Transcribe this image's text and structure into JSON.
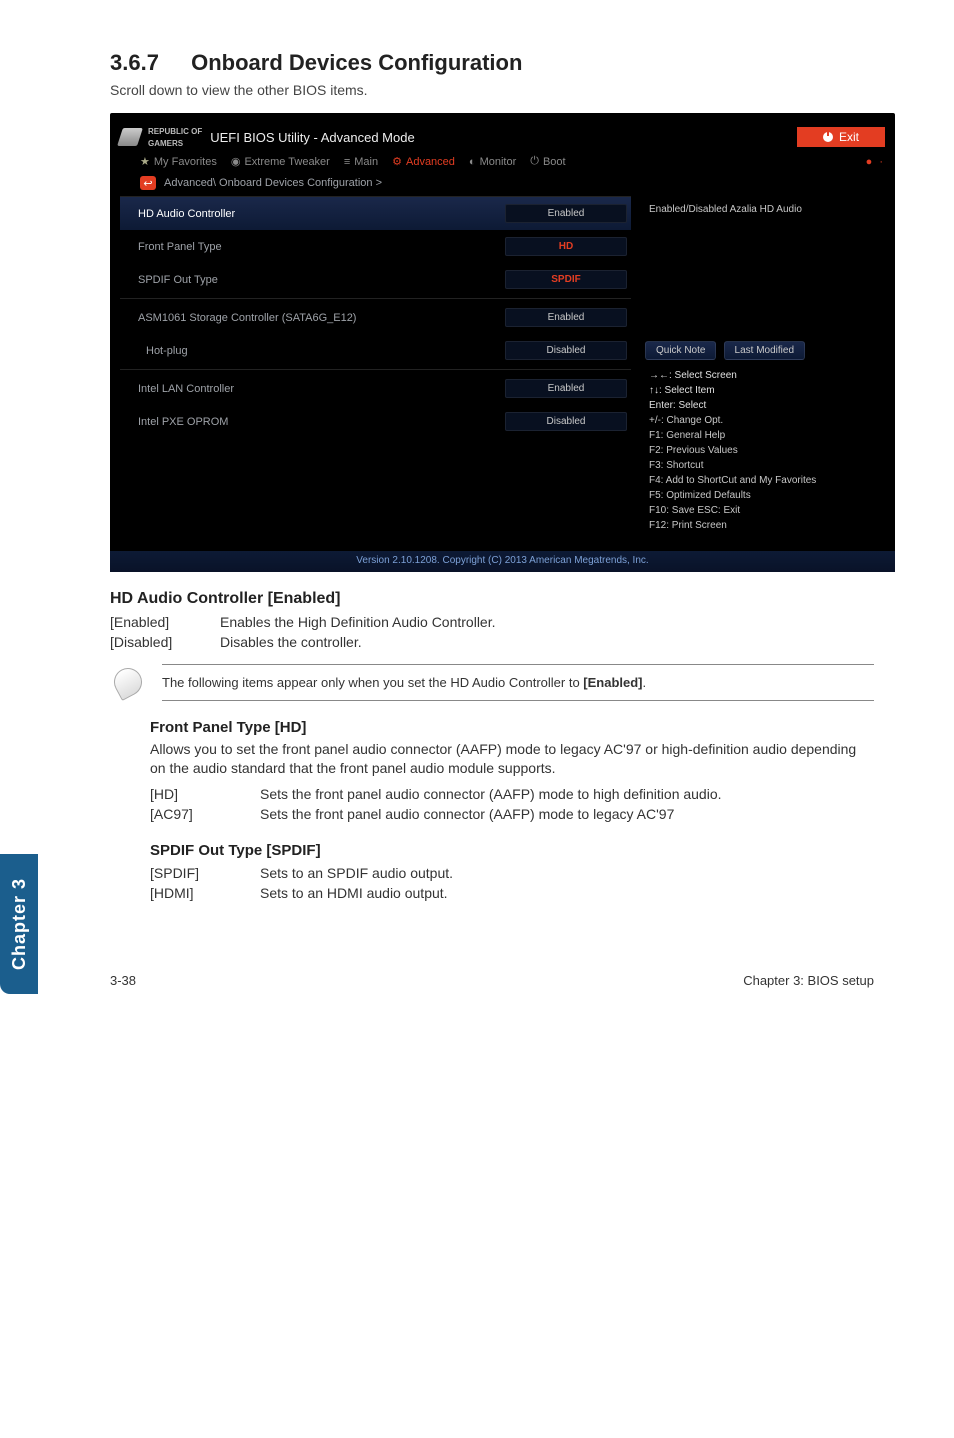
{
  "section": {
    "num": "3.6.7",
    "title": "Onboard Devices Configuration"
  },
  "scroll_hint": "Scroll down to view the other BIOS items.",
  "bios": {
    "rog_line1": "REPUBLIC OF",
    "rog_line2": "GAMERS",
    "title": "UEFI BIOS Utility - Advanced Mode",
    "exit": "Exit",
    "tabs": {
      "fav": "My Favorites",
      "et": "Extreme Tweaker",
      "main": "Main",
      "adv": "Advanced",
      "mon": "Monitor",
      "boot": "Boot"
    },
    "path": "Advanced\\ Onboard Devices Configuration >",
    "rows": {
      "hd_audio": {
        "label": "HD Audio Controller",
        "value": "Enabled"
      },
      "front_panel": {
        "label": "Front Panel Type",
        "value": "HD"
      },
      "spdif": {
        "label": "SPDIF Out Type",
        "value": "SPDIF"
      },
      "asm": {
        "label": "ASM1061 Storage Controller (SATA6G_E12)",
        "value": "Enabled"
      },
      "hotplug": {
        "label": "Hot-plug",
        "value": "Disabled"
      },
      "lan": {
        "label": "Intel LAN Controller",
        "value": "Enabled"
      },
      "pxe": {
        "label": "Intel PXE OPROM",
        "value": "Disabled"
      }
    },
    "desc": "Enabled/Disabled Azalia HD Audio",
    "qn": "Quick Note",
    "lm": "Last Modified",
    "help": {
      "l1": "→←: Select Screen",
      "l2": "↑↓: Select Item",
      "l3": "Enter: Select",
      "l4": "+/-: Change Opt.",
      "l5": "F1: General Help",
      "l6": "F2: Previous Values",
      "l7": "F3: Shortcut",
      "l8": "F4: Add to ShortCut and My Favorites",
      "l9": "F5: Optimized Defaults",
      "l10": "F10: Save  ESC: Exit",
      "l11": "F12: Print Screen"
    },
    "footer": "Version 2.10.1208. Copyright (C) 2013 American Megatrends, Inc."
  },
  "doc": {
    "hd_title": "HD Audio Controller [Enabled]",
    "hd_en_k": "[Enabled]",
    "hd_en_v": "Enables the High Definition Audio Controller.",
    "hd_dis_k": "[Disabled]",
    "hd_dis_v": "Disables the controller.",
    "note": "The following items appear only when you set the HD Audio Controller to ",
    "note_b": "[Enabled]",
    "fp_title": "Front Panel Type [HD]",
    "fp_para": "Allows you to set the front panel audio connector (AAFP) mode to legacy AC'97 or high-definition audio depending on the audio standard that the front panel audio module supports.",
    "fp_hd_k": "[HD]",
    "fp_hd_v": "Sets the front panel audio connector (AAFP) mode to high definition audio.",
    "fp_ac_k": "[AC97]",
    "fp_ac_v": "Sets the front panel audio connector (AAFP) mode to legacy AC'97",
    "sp_title": "SPDIF Out Type [SPDIF]",
    "sp_sp_k": "[SPDIF]",
    "sp_sp_v": "Sets to an SPDIF audio output.",
    "sp_hd_k": "[HDMI]",
    "sp_hd_v": "Sets to an HDMI audio output."
  },
  "side_tab": "Chapter 3",
  "footer": {
    "left": "3-38",
    "right": "Chapter 3: BIOS setup"
  }
}
